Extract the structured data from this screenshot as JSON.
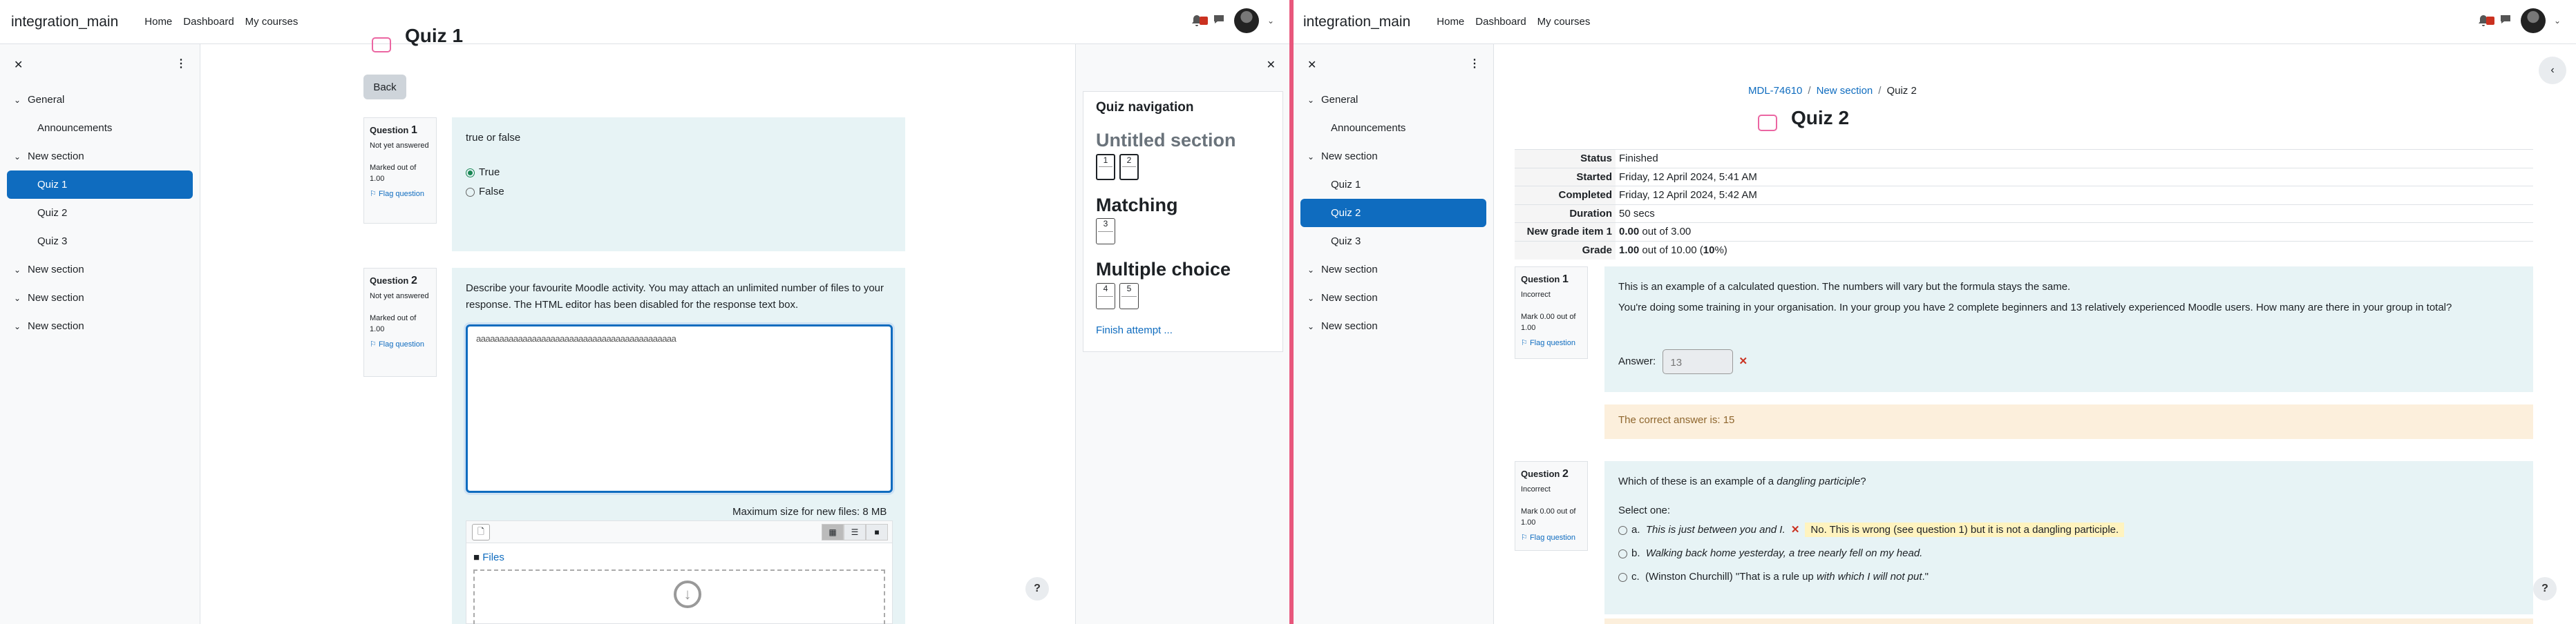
{
  "navbar": {
    "brand": "integration_main",
    "links": [
      "Home",
      "Dashboard",
      "My courses"
    ]
  },
  "course_index": {
    "sections": [
      {
        "name": "General",
        "items": [
          "Announcements"
        ]
      },
      {
        "name": "New section",
        "items": [
          "Quiz 1",
          "Quiz 2",
          "Quiz 3"
        ]
      },
      {
        "name": "New section"
      },
      {
        "name": "New section"
      },
      {
        "name": "New section"
      }
    ]
  },
  "left": {
    "title_fragment": "Quiz 1",
    "back_label": "Back",
    "q1": {
      "number_label": "Question",
      "number": "1",
      "state": "Not yet answered",
      "marks": "Marked out of 1.00",
      "flag": "Flag question",
      "text": "true or false",
      "options": [
        "True",
        "False"
      ]
    },
    "q2": {
      "number_label": "Question",
      "number": "2",
      "state": "Not yet answered",
      "marks": "Marked out of 1.00",
      "flag": "Flag question",
      "text": "Describe your favourite Moodle activity. You may attach an unlimited number of files to your response. The HTML editor has been disabled for the response text box.",
      "response": "aaaaaaaaaaaaaaaaaaaaaaaaaaaaaaaaaaaaaaaaaaa"
    },
    "max_size": "Maximum size for new files: 8 MB",
    "files_label": "Files",
    "help": "?"
  },
  "quiz_nav": {
    "title": "Quiz navigation",
    "sections": [
      {
        "name": "Untitled section",
        "questions": [
          "1",
          "2"
        ]
      },
      {
        "name": "Matching",
        "questions": [
          "3"
        ]
      },
      {
        "name": "Multiple choice",
        "questions": [
          "4",
          "5"
        ]
      }
    ],
    "finish": "Finish attempt ..."
  },
  "right": {
    "breadcrumb": [
      "MDL-74610",
      "New section",
      "Quiz 2"
    ],
    "title": "Quiz 2",
    "summary": [
      {
        "label": "Status",
        "value": "Finished"
      },
      {
        "label": "Started",
        "value": "Friday, 12 April 2024, 5:41 AM"
      },
      {
        "label": "Completed",
        "value": "Friday, 12 April 2024, 5:42 AM"
      },
      {
        "label": "Duration",
        "value": "50 secs"
      },
      {
        "label": "New grade item 1",
        "bold": "0.00",
        "value": " out of 3.00"
      },
      {
        "label": "Grade",
        "bold": "1.00",
        "value": " out of 10.00 (",
        "bold2": "10",
        "value2": "%)"
      }
    ],
    "q1": {
      "number_label": "Question",
      "number": "1",
      "state": "Incorrect",
      "marks": "Mark 0.00 out of 1.00",
      "flag": "Flag question",
      "text1": "This is an example of a calculated question. The numbers will vary but the formula stays the same.",
      "text2": "You're doing some training in your organisation. In your group you have 2 complete beginners and 13 relatively experienced Moodle users. How many are there in your group in total?",
      "answer_label": "Answer:",
      "answer": "13",
      "feedback": "The correct answer is: 15"
    },
    "q2": {
      "number_label": "Question",
      "number": "2",
      "state": "Incorrect",
      "marks": "Mark 0.00 out of 1.00",
      "flag": "Flag question",
      "text_pre": "Which of these is an example of a ",
      "text_em": "dangling participle",
      "text_post": "?",
      "select": "Select one:",
      "options": [
        {
          "letter": "a.",
          "text": "This is just between you and I.",
          "feedback": "No. This is wrong (see question 1) but it is not a dangling participle."
        },
        {
          "letter": "b.",
          "text": "Walking back home yesterday, a tree nearly fell on my head."
        },
        {
          "letter": "c.",
          "pre": "(Winston Churchill) \"That is a rule up ",
          "em": "with which I will not put",
          "post": ".\""
        }
      ]
    },
    "help": "?"
  }
}
